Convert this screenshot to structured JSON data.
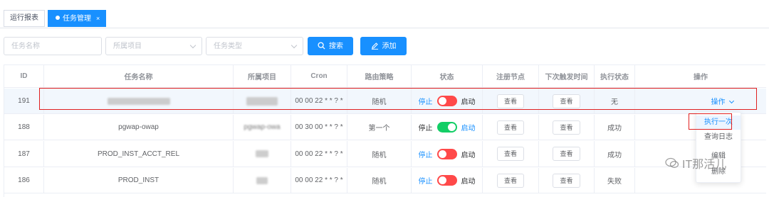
{
  "tabs": [
    {
      "label": "运行报表",
      "active": false
    },
    {
      "label": "任务管理",
      "active": true,
      "close": "×"
    }
  ],
  "filters": {
    "task_name_placeholder": "任务名称",
    "project_placeholder": "所属项目",
    "task_type_placeholder": "任务类型",
    "search_label": "搜索",
    "add_label": "添加"
  },
  "table": {
    "headers": [
      "ID",
      "任务名称",
      "所属项目",
      "Cron",
      "路由策略",
      "状态",
      "注册节点",
      "下次触发时间",
      "执行状态",
      "操作"
    ],
    "rows": [
      {
        "id": "191",
        "name": "",
        "project": "",
        "cron": "00 00 22 * * ? *",
        "route": "随机",
        "stop": "停止",
        "start": "启动",
        "running": false,
        "node_btn": "查看",
        "next_btn": "查看",
        "exec_status": "无",
        "op": "操作"
      },
      {
        "id": "188",
        "name": "pgwap-owap",
        "project": "pgwap-owa",
        "cron": "00 30 00 * * ? *",
        "route": "第一个",
        "stop": "停止",
        "start": "启动",
        "running": true,
        "node_btn": "查看",
        "next_btn": "查看",
        "exec_status": "成功",
        "op": ""
      },
      {
        "id": "187",
        "name": "PROD_INST_ACCT_REL",
        "project": "",
        "cron": "00 00 22 * * ? *",
        "route": "随机",
        "stop": "停止",
        "start": "启动",
        "running": false,
        "node_btn": "查看",
        "next_btn": "查看",
        "exec_status": "成功",
        "op": ""
      },
      {
        "id": "186",
        "name": "PROD_INST",
        "project": "",
        "cron": "00 00 22 * * ? *",
        "route": "随机",
        "stop": "停止",
        "start": "启动",
        "running": false,
        "node_btn": "查看",
        "next_btn": "查看",
        "exec_status": "失败",
        "op": ""
      }
    ]
  },
  "dropdown": {
    "items": [
      "执行一次",
      "查询日志",
      "编辑",
      "删除"
    ]
  },
  "watermark": "IT那活儿",
  "colors": {
    "primary": "#1890ff",
    "switch_off": "#ff4949",
    "switch_on": "#13ce66",
    "highlight": "#e02020"
  }
}
